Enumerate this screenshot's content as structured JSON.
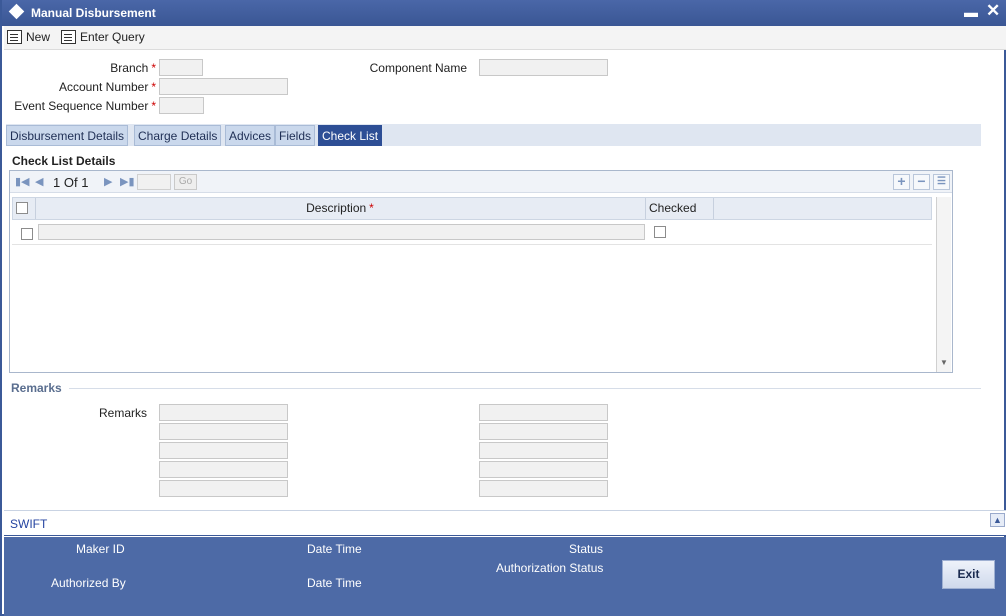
{
  "window": {
    "title": "Manual Disbursement"
  },
  "toolbar": {
    "new_label": "New",
    "enter_query_label": "Enter Query"
  },
  "form": {
    "branch_label": "Branch",
    "account_number_label": "Account Number",
    "event_sequence_label": "Event Sequence Number",
    "component_name_label": "Component Name",
    "required_marker": "*"
  },
  "tabs": [
    {
      "label": "Disbursement Details"
    },
    {
      "label": "Charge Details"
    },
    {
      "label": "Advices"
    },
    {
      "label": "Fields"
    },
    {
      "label": "Check List"
    }
  ],
  "checklist": {
    "section_title": "Check List Details",
    "pager": {
      "current": "1",
      "of_label": "Of",
      "total": "1",
      "go_label": "Go"
    },
    "columns": {
      "description": "Description",
      "checked": "Checked"
    }
  },
  "remarks": {
    "legend": "Remarks",
    "label": "Remarks"
  },
  "swift": {
    "label": "SWIFT"
  },
  "footer": {
    "maker_id_label": "Maker ID",
    "date_time_label": "Date Time",
    "status_label": "Status",
    "authorized_by_label": "Authorized By",
    "authorization_status_label": "Authorization Status",
    "exit_label": "Exit"
  },
  "colors": {
    "title_bar": "#3a5694",
    "active_tab": "#2d4e95",
    "footer": "#4d6aa6",
    "required": "#cc0000"
  }
}
